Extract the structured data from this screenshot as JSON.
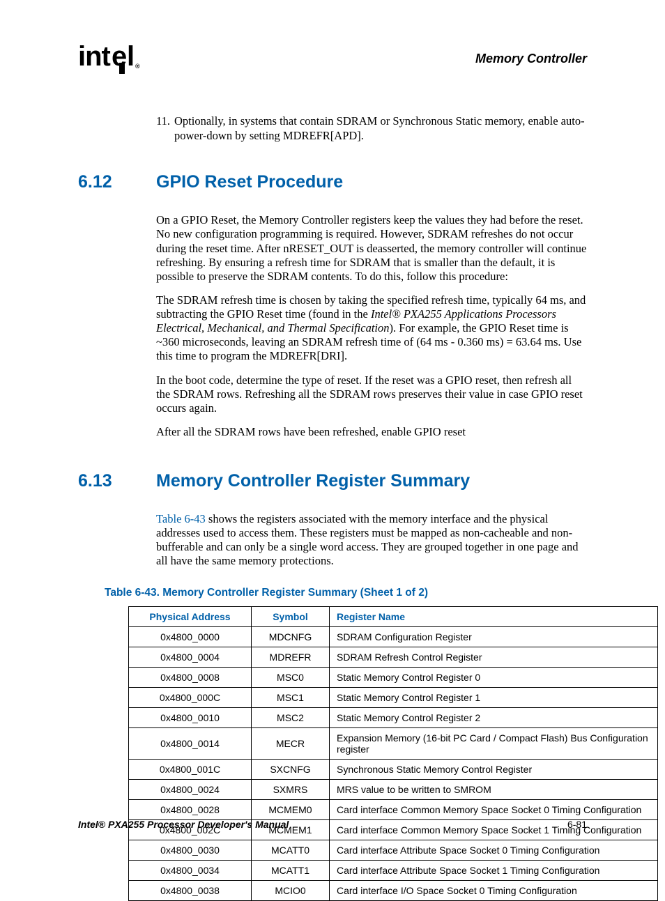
{
  "header": {
    "logo_text": "intel",
    "chapter_title": "Memory Controller"
  },
  "list_item": {
    "number": "11.",
    "text": "Optionally, in systems that contain SDRAM or Synchronous Static memory, enable auto-power-down by setting MDREFR[APD]."
  },
  "section_612": {
    "number": "6.12",
    "title": "GPIO Reset Procedure",
    "p1": "On a GPIO Reset, the Memory Controller registers keep the values they had before the reset. No new configuration programming is required. However, SDRAM refreshes do not occur during the reset time. After nRESET_OUT is deasserted, the memory controller will continue refreshing. By ensuring a refresh time for SDRAM that is smaller than the default, it is possible to preserve the SDRAM contents. To do this, follow this procedure:",
    "p2_a": "The SDRAM refresh time is chosen by taking the specified refresh time, typically 64 ms, and subtracting the GPIO Reset time (found in the ",
    "p2_i": "Intel® PXA255 Applications Processors Electrical, Mechanical, and Thermal Specification",
    "p2_b": "). For example, the GPIO Reset time is ~360 microseconds, leaving an SDRAM refresh time of (64 ms - 0.360 ms) = 63.64 ms. Use this time to program the MDREFR[DRI].",
    "p3": "In the boot code, determine the type of reset. If the reset was a GPIO reset, then refresh all the SDRAM rows. Refreshing all the SDRAM rows preserves their value in case GPIO reset occurs again.",
    "p4": "After all the SDRAM rows have been refreshed, enable GPIO reset"
  },
  "section_613": {
    "number": "6.13",
    "title": "Memory Controller Register Summary",
    "p1_xref": "Table 6-43",
    "p1_rest": " shows the registers associated with the memory interface and the physical addresses used to access them. These registers must be mapped as non-cacheable and non-bufferable and can only be a single word access. They are grouped together in one page and all have the same memory protections."
  },
  "table": {
    "caption": "Table 6-43. Memory Controller Register Summary (Sheet 1 of 2)",
    "headers": {
      "c1": "Physical Address",
      "c2": "Symbol",
      "c3": "Register Name"
    },
    "rows": [
      {
        "addr": "0x4800_0000",
        "sym": "MDCNFG",
        "name": "SDRAM Configuration Register"
      },
      {
        "addr": "0x4800_0004",
        "sym": "MDREFR",
        "name": "SDRAM Refresh Control Register"
      },
      {
        "addr": "0x4800_0008",
        "sym": "MSC0",
        "name": "Static Memory Control Register 0"
      },
      {
        "addr": "0x4800_000C",
        "sym": "MSC1",
        "name": "Static Memory Control Register 1"
      },
      {
        "addr": "0x4800_0010",
        "sym": "MSC2",
        "name": "Static Memory Control Register 2"
      },
      {
        "addr": "0x4800_0014",
        "sym": "MECR",
        "name": "Expansion Memory (16-bit PC Card / Compact Flash) Bus Configuration register"
      },
      {
        "addr": "0x4800_001C",
        "sym": "SXCNFG",
        "name": "Synchronous Static Memory Control Register"
      },
      {
        "addr": "0x4800_0024",
        "sym": "SXMRS",
        "name": "MRS value to be written to SMROM"
      },
      {
        "addr": "0x4800_0028",
        "sym": "MCMEM0",
        "name": "Card interface Common Memory Space Socket 0 Timing Configuration"
      },
      {
        "addr": "0x4800_002C",
        "sym": "MCMEM1",
        "name": "Card interface Common Memory Space Socket 1 Timing Configuration"
      },
      {
        "addr": "0x4800_0030",
        "sym": "MCATT0",
        "name": "Card interface Attribute Space Socket 0 Timing Configuration"
      },
      {
        "addr": "0x4800_0034",
        "sym": "MCATT1",
        "name": "Card interface Attribute Space Socket 1 Timing Configuration"
      },
      {
        "addr": "0x4800_0038",
        "sym": "MCIO0",
        "name": "Card interface I/O Space Socket 0 Timing Configuration"
      }
    ]
  },
  "footer": {
    "title": "Intel® PXA255 Processor Developer's Manual",
    "page": "6-81"
  }
}
